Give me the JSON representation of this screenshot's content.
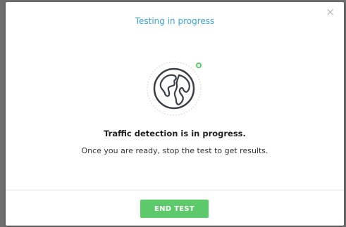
{
  "modal": {
    "title": "Testing in progress",
    "close_glyph": "×",
    "close_icon": "close-icon",
    "illustration_icon": "globe-icon",
    "status_dot_color": "#5cc96b",
    "headline": "Traffic detection is in progress.",
    "subtext": "Once you are ready, stop the test to get results.",
    "end_button_label": "END TEST",
    "accent_color": "#3aa2dc",
    "button_color": "#5cc96b"
  }
}
